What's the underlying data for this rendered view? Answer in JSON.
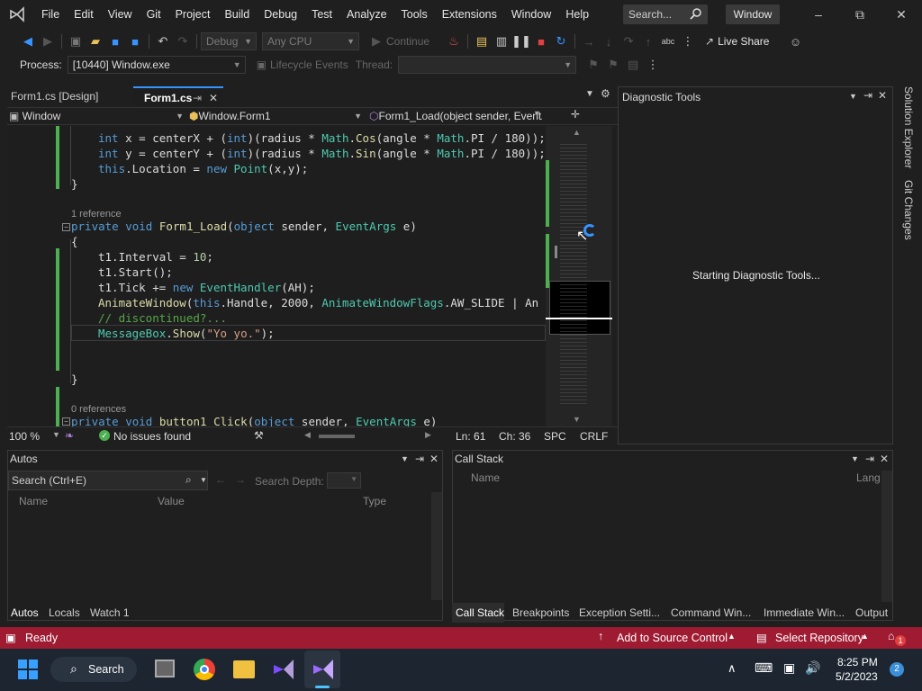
{
  "menu": [
    "File",
    "Edit",
    "View",
    "Git",
    "Project",
    "Build",
    "Debug",
    "Test",
    "Analyze",
    "Tools",
    "Extensions",
    "Window",
    "Help"
  ],
  "search_placeholder": "Search...",
  "window_badge": "Window",
  "toolbar": {
    "config": "Debug",
    "platform": "Any CPU",
    "continue": "Continue",
    "live_share": "Live Share"
  },
  "process": {
    "label": "Process:",
    "value": "[10440] Window.exe",
    "lifecycle": "Lifecycle Events",
    "thread": "Thread:"
  },
  "tabs": [
    {
      "label": "Form1.cs [Design]"
    },
    {
      "label": "Form1.cs"
    }
  ],
  "nav": {
    "project": "Window",
    "class": "Window.Form1",
    "member": "Form1_Load(object sender, EventArgs e)"
  },
  "code": {
    "l1a": "int",
    "l1b": " x = centerX + (",
    "l1c": "int",
    "l1d": ")(radius * ",
    "l1e": "Math",
    "l1f": ".",
    "l1g": "Cos",
    "l1h": "(angle * ",
    "l1i": "Math",
    "l1j": ".PI / 180));",
    "l2a": "int",
    "l2b": " y = centerY + (",
    "l2c": "int",
    "l2d": ")(radius * ",
    "l2e": "Math",
    "l2f": ".",
    "l2g": "Sin",
    "l2h": "(angle * ",
    "l2i": "Math",
    "l2j": ".PI / 180));",
    "l3a": "this",
    "l3b": ".Location = ",
    "l3c": "new",
    "l3d": " ",
    "l3e": "Point",
    "l3f": "(x,y);",
    "brace_close": "}",
    "ref1": "1 reference",
    "sig_a": "private",
    "sig_b": " ",
    "sig_c": "void",
    "sig_d": " ",
    "sig_e": "Form1_Load",
    "sig_f": "(",
    "sig_g": "object",
    "sig_h": " sender, ",
    "sig_i": "EventArgs",
    "sig_j": " e)",
    "brace_open": "{",
    "l5a": "t1.Interval = ",
    "l5b": "10",
    ";": ";",
    "l6": "t1.Start();",
    "l7a": "t1.Tick += ",
    "l7b": "new",
    "l7c": " ",
    "l7d": "EventHandler",
    "l7e": "(AH);",
    "l8a": "AnimateWindow",
    "l8b": "(",
    "l8c": "this",
    "l8d": ".Handle, 2000, ",
    "l8e": "AnimateWindowFlags",
    "l8f": ".AW_SLIDE | An",
    "l9": "// discontinued?...",
    "l10a": "MessageBox",
    "l10b": ".",
    "l10c": "Show",
    "l10d": "(",
    "l10e": "\"Yo yo.\"",
    "l10f": ");",
    "ref2": "0 references",
    "sig2_a": "private",
    "sig2_b": " ",
    "sig2_c": "void",
    "sig2_d": " ",
    "sig2_e": "button1_Click",
    "sig2_f": "(",
    "sig2_g": "object",
    "sig2_h": " sender, ",
    "sig2_i": "EventArgs",
    "sig2_j": " e)"
  },
  "status": {
    "zoom": "100 %",
    "issues": "No issues found",
    "ln": "Ln: 61",
    "ch": "Ch: 36",
    "spc": "SPC",
    "crlf": "CRLF"
  },
  "diag": {
    "title": "Diagnostic Tools",
    "message": "Starting Diagnostic Tools..."
  },
  "side_tabs": [
    "Solution Explorer",
    "Git Changes"
  ],
  "autos": {
    "title": "Autos",
    "search": "Search (Ctrl+E)",
    "depth": "Search Depth:",
    "cols": [
      "Name",
      "Value",
      "Type"
    ],
    "tabs": [
      "Autos",
      "Locals",
      "Watch 1"
    ]
  },
  "callstack": {
    "title": "Call Stack",
    "cols": [
      "Name",
      "Lang"
    ],
    "tabs": [
      "Call Stack",
      "Breakpoints",
      "Exception Setti...",
      "Command Win...",
      "Immediate Win...",
      "Output"
    ]
  },
  "statusbar": {
    "ready": "Ready",
    "source": "Add to Source Control",
    "repo": "Select Repository",
    "notif": "1"
  },
  "taskbar": {
    "search": "Search",
    "time": "8:25 PM",
    "date": "5/2/2023",
    "badge": "2"
  },
  "colors": {
    "accent": "#9e1b32",
    "keyword": "#569cd6",
    "type": "#4ec9b0"
  }
}
